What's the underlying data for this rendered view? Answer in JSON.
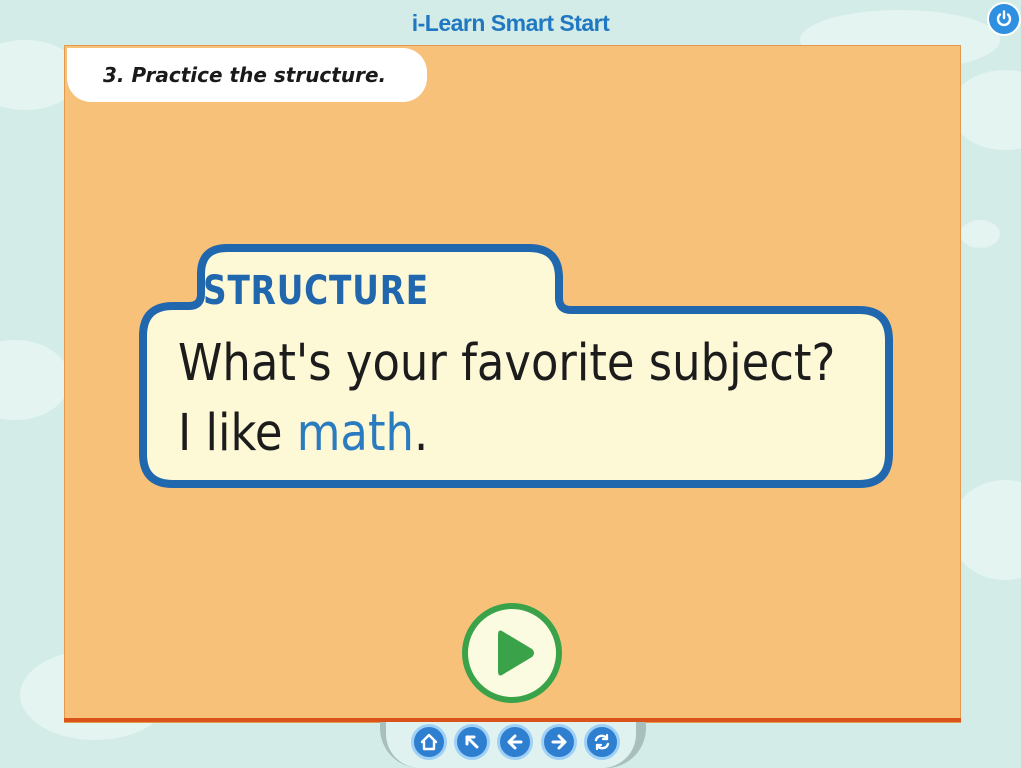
{
  "app": {
    "title": "i-Learn Smart Start"
  },
  "instruction": {
    "label": "3. Practice the structure."
  },
  "structure": {
    "heading": "STRUCTURE",
    "question": "What's your favorite subject?",
    "answer_prefix": "I like ",
    "answer_keyword": "math",
    "answer_suffix": "."
  },
  "controls": {
    "power_icon": "power-icon",
    "play_icon": "play-icon",
    "nav_icons": [
      "home-icon",
      "arrow-up-left-icon",
      "arrow-left-icon",
      "arrow-right-icon",
      "refresh-icon"
    ]
  },
  "colors": {
    "background": "#d4ece7",
    "stage": "#f8c17a",
    "card_fill": "#fdf8d6",
    "card_border": "#2067ad",
    "accent_blue": "#2a7bbf",
    "play_green": "#3aa34a"
  }
}
